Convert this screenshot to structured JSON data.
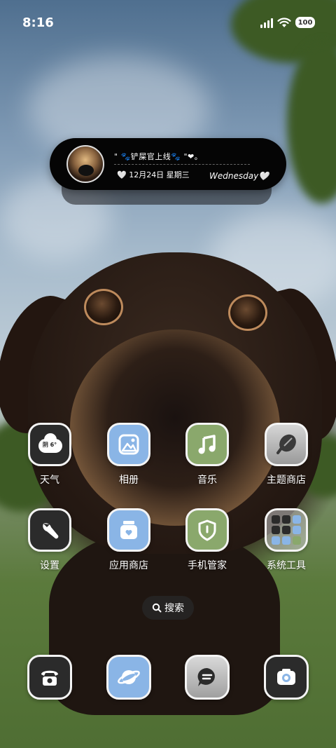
{
  "status": {
    "time": "8:16",
    "battery": "100"
  },
  "widget": {
    "quote_line": "\"  🐾铲屎官上线🐾   \"❤︎。",
    "date_line": "🤍 12月24日  星期三",
    "day_name": "Wednesday🤍"
  },
  "weather": {
    "text": "阴 6°"
  },
  "apps": {
    "weather": "天气",
    "gallery": "相册",
    "music": "音乐",
    "themes": "主题商店",
    "settings": "设置",
    "appstore": "应用商店",
    "phone_manager": "手机管家",
    "system_tools": "系统工具"
  },
  "search": {
    "label": "搜索"
  },
  "dock": {
    "items": [
      "phone-icon",
      "browser-icon",
      "messages-icon",
      "camera-icon"
    ]
  },
  "colors": {
    "icon_blue": "#8ab5e6",
    "icon_green": "#8aa86c",
    "icon_dark": "#2b2b2b"
  }
}
